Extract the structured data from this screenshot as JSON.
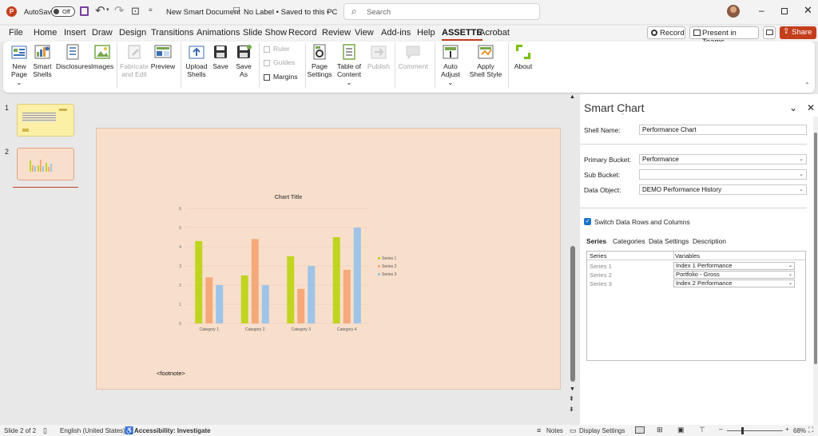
{
  "titlebar": {
    "autosave_label": "AutoSave",
    "autosave_state": "Off",
    "doc_title": "New Smart Document",
    "sensitivity": "No Label • Saved to this PC",
    "search_placeholder": "Search",
    "accent": "#c43e1c"
  },
  "menu": {
    "tabs": [
      "File",
      "Home",
      "Insert",
      "Draw",
      "Design",
      "Transitions",
      "Animations",
      "Slide Show",
      "Record",
      "Review",
      "View",
      "Add-ins",
      "Help",
      "ASSETTE",
      "Acrobat"
    ],
    "record_label": "Record",
    "present_label": "Present in Teams",
    "share_label": "Share"
  },
  "ribbon": {
    "new_page": [
      "New",
      "Page"
    ],
    "smart_shells": [
      "Smart",
      "Shells"
    ],
    "disclosures": "Disclosures",
    "images": "Images",
    "fabricate": [
      "Fabricate",
      "and Edit"
    ],
    "preview": "Preview",
    "upload": [
      "Upload",
      "Shells"
    ],
    "save": "Save",
    "save_as": [
      "Save",
      "As"
    ],
    "ruler": "Ruler",
    "guides": "Guides",
    "margins": "Margins",
    "page_settings": [
      "Page",
      "Settings"
    ],
    "toc": [
      "Table of",
      "Content"
    ],
    "publish": "Publish",
    "comment": "Comment",
    "auto_adjust": [
      "Auto",
      "Adjust"
    ],
    "apply_style": [
      "Apply",
      "Shell Style"
    ],
    "about": "About"
  },
  "thumbnails": [
    "1",
    "2"
  ],
  "slide": {
    "footnote": "<footnote>"
  },
  "chart_data": {
    "type": "bar",
    "title": "Chart Title",
    "categories": [
      "Category 1",
      "Category 2",
      "Category 3",
      "Category 4"
    ],
    "series": [
      {
        "name": "Series 1",
        "values": [
          4.3,
          2.5,
          3.5,
          4.5
        ],
        "color": "#c0d51f"
      },
      {
        "name": "Series 2",
        "values": [
          2.4,
          4.4,
          1.8,
          2.8
        ],
        "color": "#f5a97a"
      },
      {
        "name": "Series 3",
        "values": [
          2.0,
          2.0,
          3.0,
          5.0
        ],
        "color": "#9ec4e8"
      }
    ],
    "yticks": [
      "0",
      "1",
      "2",
      "3",
      "4",
      "5",
      "6"
    ],
    "ylim": [
      0,
      6
    ],
    "grid": true,
    "legend": "right"
  },
  "pane": {
    "title": "Smart Chart",
    "shell_name_label": "Shell Name:",
    "shell_name_value": "Performance Chart",
    "primary_bucket_label": "Primary Bucket:",
    "primary_bucket_value": "Performance",
    "sub_bucket_label": "Sub Bucket:",
    "sub_bucket_value": "",
    "data_object_label": "Data Object:",
    "data_object_value": "DEMO Performance History",
    "switch_label": "Switch Data Rows and Columns",
    "tabs": [
      "Series",
      "Categories",
      "Data Settings",
      "Description"
    ],
    "table_headers": [
      "Series",
      "Variables"
    ],
    "rows": [
      {
        "series": "Series 1",
        "variable": "Index 1 Performance"
      },
      {
        "series": "Series 2",
        "variable": "Portfolio - Gross"
      },
      {
        "series": "Series 3",
        "variable": "Index 2 Performance"
      }
    ]
  },
  "status": {
    "slide": "Slide 2 of 2",
    "language": "English (United States)",
    "accessibility": "Accessibility: Investigate",
    "notes": "Notes",
    "display": "Display Settings",
    "zoom": "68%"
  }
}
